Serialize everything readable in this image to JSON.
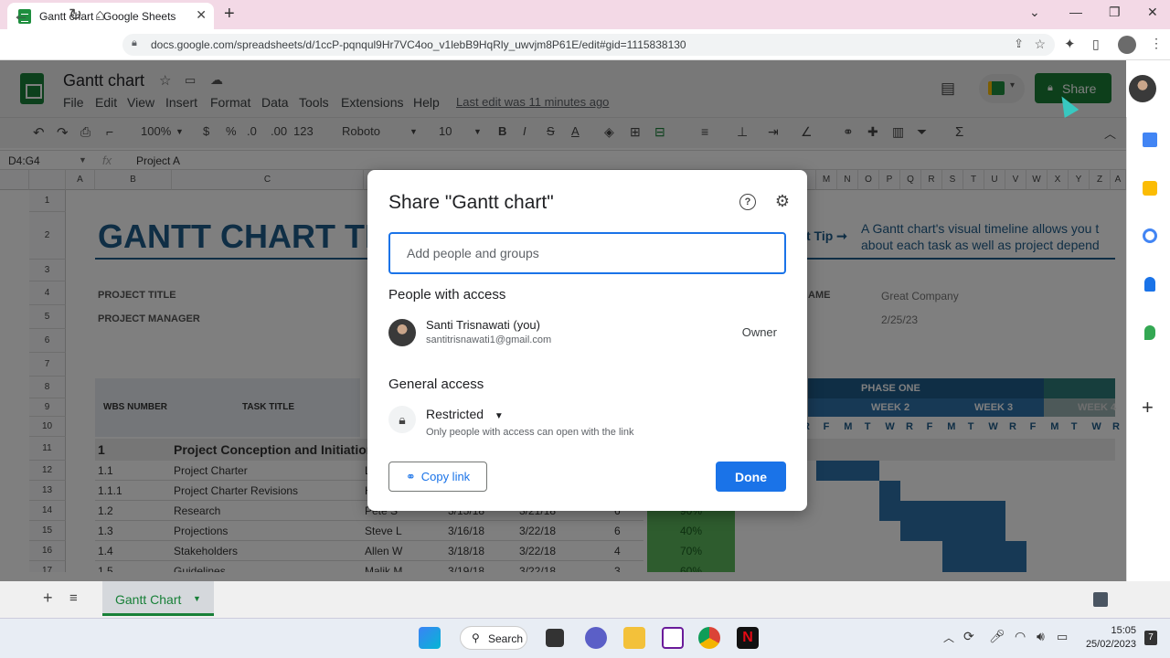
{
  "browser": {
    "tab_title": "Gantt chart - Google Sheets",
    "url": "docs.google.com/spreadsheets/d/1ccP-pqnqul9Hr7VC4oo_v1lebB9HqRly_uwvjm8P61E/edit#gid=1115838130"
  },
  "sheets": {
    "doc_title": "Gantt chart",
    "menu": [
      "File",
      "Edit",
      "View",
      "Insert",
      "Format",
      "Data",
      "Tools",
      "Extensions",
      "Help"
    ],
    "last_edit": "Last edit was 11 minutes ago",
    "share_label": "Share",
    "toolbar": {
      "zoom": "100%",
      "currency": "$",
      "percent": "%",
      "dec_dec": ".0",
      "dec_inc": ".00",
      "fmt": "123",
      "font": "Roboto",
      "size": "10",
      "bold": "B",
      "italic": "I",
      "strike": "S",
      "textcolor": "A"
    },
    "name_box": "D4:G4",
    "formula": "Project A",
    "columns": [
      "A",
      "B",
      "C",
      "M",
      "N",
      "O",
      "P",
      "Q",
      "R",
      "S",
      "T",
      "U",
      "V",
      "W",
      "X",
      "Y",
      "Z",
      "A"
    ],
    "rows": [
      "1",
      "2",
      "3",
      "4",
      "5",
      "6",
      "7",
      "8",
      "9",
      "10",
      "11",
      "12",
      "13",
      "14",
      "15",
      "16",
      "17"
    ],
    "heading": "GANTT CHART TE",
    "tip": "t Tip ➞",
    "tip_text_1": "A Gantt chart's visual timeline allows you t",
    "tip_text_2": "about each task as well as project depend",
    "project_title_label": "PROJECT TITLE",
    "project_manager_label": "PROJECT MANAGER",
    "company_label": "AME",
    "company_value": "Great Company",
    "date_value": "2/25/23",
    "wbs_label": "WBS NUMBER",
    "task_label": "TASK TITLE",
    "phase": "PHASE ONE",
    "weeks": [
      "WEEK 2",
      "WEEK 3",
      "WEEK 4"
    ],
    "days": [
      "R",
      "F",
      "M",
      "T",
      "W",
      "R",
      "F",
      "M",
      "T",
      "W",
      "R",
      "F",
      "M",
      "T",
      "W",
      "R"
    ],
    "section_num": "1",
    "section_title": "Project Conception and Initiation",
    "tasks": [
      {
        "num": "1.1",
        "title": "Project Charter",
        "owner": "L",
        "start": "",
        "end": "",
        "days": "",
        "pct": ""
      },
      {
        "num": "1.1.1",
        "title": "Project Charter Revisions",
        "owner": "H",
        "start": "",
        "end": "",
        "days": "",
        "pct": ""
      },
      {
        "num": "1.2",
        "title": "Research",
        "owner": "Pete S",
        "start": "3/15/18",
        "end": "3/21/18",
        "days": "6",
        "pct": "90%"
      },
      {
        "num": "1.3",
        "title": "Projections",
        "owner": "Steve L",
        "start": "3/16/18",
        "end": "3/22/18",
        "days": "6",
        "pct": "40%"
      },
      {
        "num": "1.4",
        "title": "Stakeholders",
        "owner": "Allen W",
        "start": "3/18/18",
        "end": "3/22/18",
        "days": "4",
        "pct": "70%"
      },
      {
        "num": "1.5",
        "title": "Guidelines",
        "owner": "Malik M",
        "start": "3/19/18",
        "end": "3/22/18",
        "days": "3",
        "pct": "60%"
      }
    ],
    "sheet_tab": "Gantt Chart"
  },
  "dialog": {
    "title": "Share \"Gantt chart\"",
    "input_placeholder": "Add people and groups",
    "people_heading": "People with access",
    "user_name": "Santi Trisnawati (you)",
    "user_email": "santitrisnawati1@gmail.com",
    "user_role": "Owner",
    "general_heading": "General access",
    "access_level": "Restricted",
    "access_desc": "Only people with access can open with the link",
    "copy_link": "Copy link",
    "done": "Done"
  },
  "taskbar": {
    "search": "Search",
    "time": "15:05",
    "date": "25/02/2023",
    "badge": "7"
  },
  "colors": {
    "accent": "#1a73e8",
    "sheets_green": "#188038",
    "phase_blue": "#1f5c8a"
  }
}
